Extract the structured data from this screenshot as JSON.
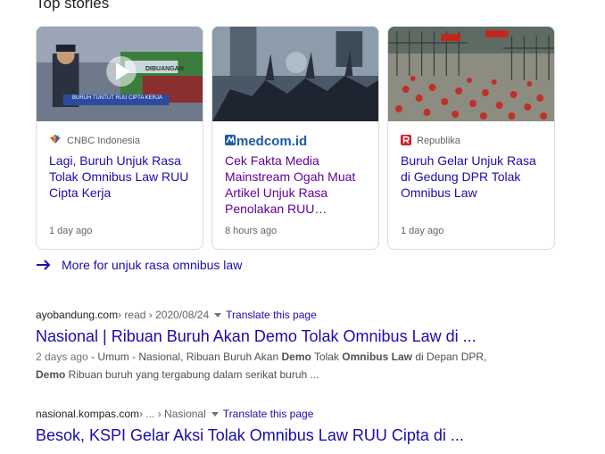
{
  "top_stories": {
    "title": "Top stories",
    "cards": [
      {
        "source": "CNBC Indonesia",
        "headline": "Lagi, Buruh Unjuk Rasa Tolak Omnibus Law RUU Cipta Kerja",
        "age": "1 day ago",
        "thumb_caption": "BURUH TUNTUT RUU CIPTA KERJA",
        "thumb_banner": "DIBUANGAN",
        "icon": "cnbc-peacock-icon"
      },
      {
        "source": "medcom.id",
        "headline": "Cek Fakta Media Mainstream Ogah Muat Artikel Unjuk Rasa Penolakan RUU…",
        "age": "8 hours ago",
        "icon": "medcom-logo"
      },
      {
        "source": "Republika",
        "headline": "Buruh Gelar Unjuk Rasa di Gedung DPR Tolak Omnibus Law",
        "age": "1 day ago",
        "icon": "republika-r-icon"
      }
    ],
    "more": "More for unjuk rasa omnibus law"
  },
  "results": [
    {
      "domain": "ayobandung.com",
      "path": " › read › 2020/08/24",
      "translate": "Translate this page",
      "title": "Nasional | Ribuan Buruh Akan Demo Tolak Omnibus Law di ...",
      "date": "2 days ago",
      "s1": " - Umum - Nasional, Ribuan Buruh Akan ",
      "b1": "Demo",
      "s2": " Tolak ",
      "b2": "Omnibus Law",
      "s3": " di Depan DPR,",
      "b3": "Demo",
      "s4": " Ribuan buruh yang tergabung dalam serikat buruh ..."
    },
    {
      "domain": "nasional.kompas.com",
      "path": " › ... › Nasional",
      "translate": "Translate this page",
      "title": "Besok, KSPI Gelar Aksi Tolak Omnibus Law RUU Cipta di ..."
    }
  ],
  "colors": {
    "link": "#1a0dab",
    "visited": "#660099",
    "muted": "#5f6368"
  }
}
